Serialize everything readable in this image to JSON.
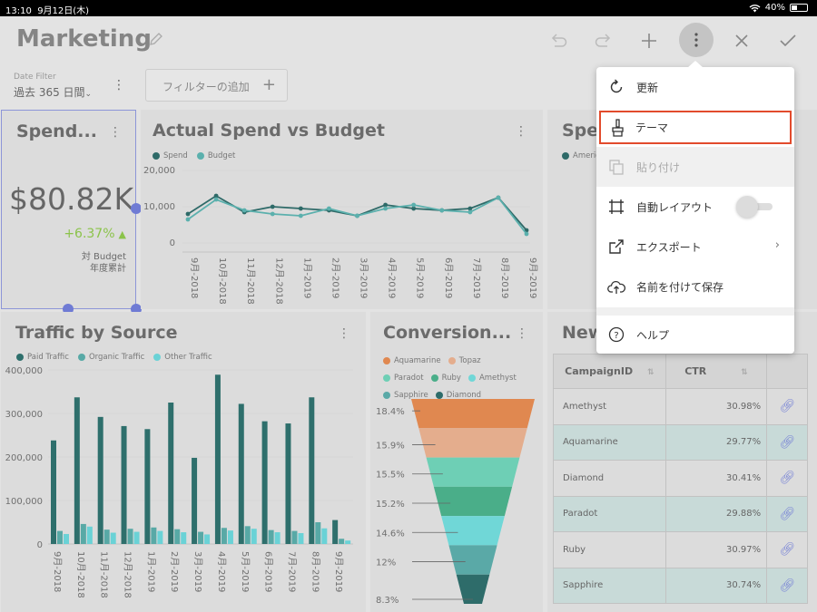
{
  "status": {
    "time": "13:10",
    "date": "9月12日(木)",
    "battery": "40%",
    "battery_level": 0.4
  },
  "header": {
    "title": "Marketing"
  },
  "filters": {
    "date_label": "Date Filter",
    "date_value": "過去 365 日間",
    "add_filter": "フィルターの追加"
  },
  "kpi": {
    "title": "Spend...",
    "value": "$80.82K",
    "delta": "+6.37%",
    "compare1": "対 Budget",
    "compare2": "年度累計"
  },
  "line_card": {
    "title": "Actual Spend vs Budget"
  },
  "spend_card": {
    "title": "Spe",
    "legend": "Americ"
  },
  "bar_card": {
    "title": "Traffic by Source"
  },
  "funnel_card": {
    "title": "Conversion..."
  },
  "table_card": {
    "title": "New",
    "columns": [
      "CampaignID",
      "CTR"
    ],
    "rows": [
      {
        "id": "Amethyst",
        "ctr": "30.98%"
      },
      {
        "id": "Aquamarine",
        "ctr": "29.77%"
      },
      {
        "id": "Diamond",
        "ctr": "30.41%"
      },
      {
        "id": "Paradot",
        "ctr": "29.88%"
      },
      {
        "id": "Ruby",
        "ctr": "30.97%"
      },
      {
        "id": "Sapphire",
        "ctr": "30.74%"
      }
    ]
  },
  "menu": {
    "items": [
      {
        "label": "更新",
        "icon": "refresh-icon"
      },
      {
        "label": "テーマ",
        "icon": "paintbrush-icon"
      },
      {
        "label": "貼り付け",
        "icon": "paste-icon"
      },
      {
        "label": "自動レイアウト",
        "icon": "crop-icon"
      },
      {
        "label": "エクスポート",
        "icon": "export-icon"
      },
      {
        "label": "名前を付けて保存",
        "icon": "cloud-save-icon"
      },
      {
        "label": "ヘルプ",
        "icon": "help-icon"
      }
    ]
  },
  "chart_data": [
    {
      "type": "line",
      "title": "Actual Spend vs Budget",
      "categories": [
        "9月-2018",
        "10月-2018",
        "11月-2018",
        "12月-2018",
        "1月-2019",
        "2月-2019",
        "3月-2019",
        "4月-2019",
        "5月-2019",
        "6月-2019",
        "7月-2019",
        "8月-2019",
        "9月-2019"
      ],
      "series": [
        {
          "name": "Spend",
          "color": "#2e6a68",
          "values": [
            8000,
            13000,
            8500,
            10000,
            9500,
            9000,
            7500,
            10500,
            9500,
            9000,
            9500,
            12500,
            3500
          ]
        },
        {
          "name": "Budget",
          "color": "#5bb0ad",
          "values": [
            6500,
            12000,
            9000,
            8000,
            7500,
            9500,
            7500,
            9500,
            10500,
            9000,
            8500,
            12500,
            2500
          ]
        }
      ],
      "yticks": [
        "0",
        "10,000",
        "20,000"
      ],
      "ylim": [
        0,
        20000
      ]
    },
    {
      "type": "bar",
      "title": "Traffic by Source",
      "categories": [
        "9月-2018",
        "10月-2018",
        "11月-2018",
        "12月-2018",
        "1月-2019",
        "2月-2019",
        "3月-2019",
        "4月-2019",
        "5月-2019",
        "6月-2019",
        "7月-2019",
        "8月-2019",
        "9月-2019"
      ],
      "series": [
        {
          "name": "Paid Traffic",
          "color": "#2e6f6c",
          "values": [
            238000,
            337000,
            292000,
            271000,
            264000,
            325000,
            198000,
            389000,
            322000,
            282000,
            277000,
            337000,
            55000
          ]
        },
        {
          "name": "Organic Traffic",
          "color": "#58a9a6",
          "values": [
            30000,
            46000,
            33000,
            35000,
            38000,
            34000,
            28000,
            37000,
            41000,
            32000,
            30000,
            50000,
            12000
          ]
        },
        {
          "name": "Other Traffic",
          "color": "#6ad2d6",
          "values": [
            23000,
            40000,
            26000,
            28000,
            30000,
            27000,
            22000,
            31000,
            35000,
            27000,
            25000,
            36000,
            8000
          ]
        }
      ],
      "yticks": [
        "0",
        "100,000",
        "200,000",
        "300,000",
        "400,000"
      ],
      "ylim": [
        0,
        400000
      ]
    },
    {
      "type": "funnel",
      "title": "Conversion...",
      "legend": [
        {
          "name": "Aquamarine",
          "color": "#e08850"
        },
        {
          "name": "Topaz",
          "color": "#e4ad8d"
        },
        {
          "name": "Paradot",
          "color": "#6ecfb5"
        },
        {
          "name": "Ruby",
          "color": "#4aae89"
        },
        {
          "name": "Amethyst",
          "color": "#70d7d7"
        },
        {
          "name": "Sapphire",
          "color": "#5aa9a7"
        },
        {
          "name": "Diamond",
          "color": "#2e6c6a"
        }
      ],
      "labels": [
        "18.4%",
        "15.9%",
        "15.5%",
        "15.2%",
        "14.6%",
        "12%",
        "8.3%"
      ],
      "values": [
        18.4,
        15.9,
        15.5,
        15.2,
        14.6,
        12,
        8.3
      ]
    }
  ]
}
